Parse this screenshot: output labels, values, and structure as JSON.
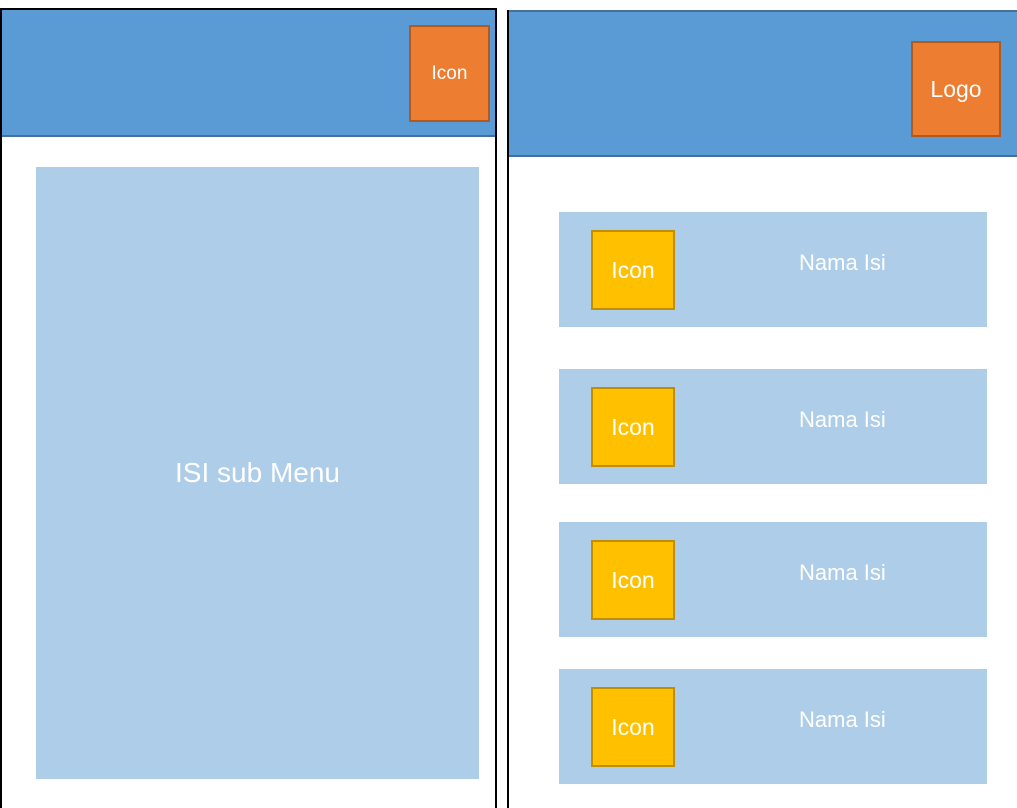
{
  "left_screen": {
    "header": {
      "icon_label": "Icon"
    },
    "content": {
      "label": "ISI sub Menu"
    }
  },
  "right_screen": {
    "header": {
      "logo_label": "Logo"
    },
    "items": [
      {
        "icon_label": "Icon",
        "label": "Nama Isi"
      },
      {
        "icon_label": "Icon",
        "label": "Nama Isi"
      },
      {
        "icon_label": "Icon",
        "label": "Nama Isi"
      },
      {
        "icon_label": "Icon",
        "label": "Nama Isi"
      }
    ]
  },
  "colors": {
    "header_blue": "#5b9bd5",
    "content_light_blue": "#aecde9",
    "icon_orange": "#ed7d31",
    "item_icon_yellow": "#ffc000",
    "text_white": "#ffffff"
  }
}
